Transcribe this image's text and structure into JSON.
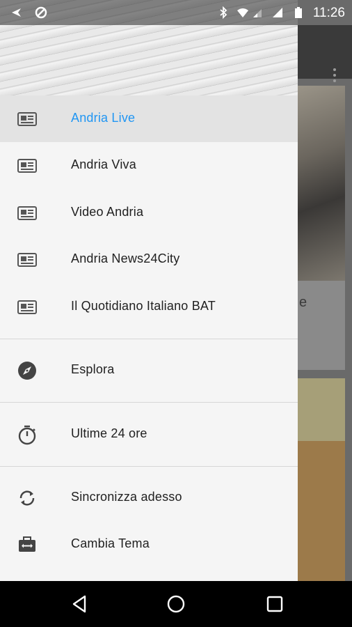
{
  "status_bar": {
    "time": "11:26"
  },
  "drawer": {
    "feeds": [
      {
        "label": "Andria Live",
        "icon": "newspaper-icon",
        "active": true
      },
      {
        "label": "Andria Viva",
        "icon": "newspaper-icon"
      },
      {
        "label": "Video Andria",
        "icon": "newspaper-icon"
      },
      {
        "label": "Andria News24City",
        "icon": "newspaper-icon"
      },
      {
        "label": "Il Quotidiano Italiano BAT",
        "icon": "newspaper-icon"
      }
    ],
    "explore": {
      "label": "Esplora",
      "icon": "compass-icon"
    },
    "recent": {
      "label": "Ultime 24 ore",
      "icon": "timer-icon"
    },
    "actions": [
      {
        "label": "Sincronizza adesso",
        "icon": "sync-icon"
      },
      {
        "label": "Cambia Tema",
        "icon": "theme-icon"
      }
    ]
  },
  "background": {
    "card_text_fragment": "e"
  },
  "colors": {
    "accent": "#2196f3",
    "drawer_bg": "#f5f5f5",
    "active_bg": "#e3e3e3"
  }
}
